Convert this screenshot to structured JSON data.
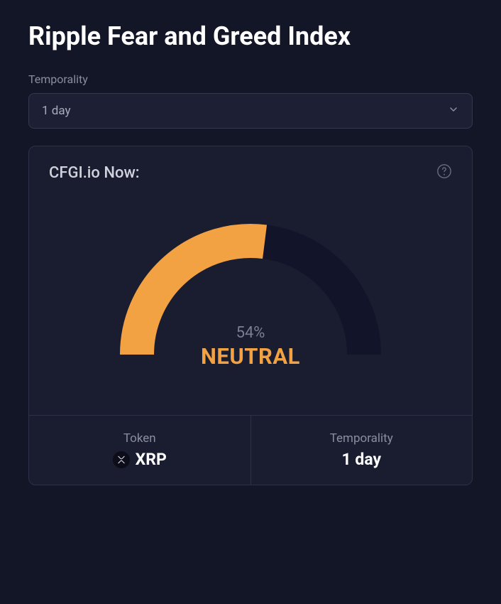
{
  "title": "Ripple Fear and Greed Index",
  "dropdown": {
    "label": "Temporality",
    "value": "1 day"
  },
  "card": {
    "title": "CFGI.io Now:",
    "gauge": {
      "percent_text": "54%",
      "label": "NEUTRAL"
    },
    "footer": {
      "token_label": "Token",
      "token_value": "XRP",
      "temporality_label": "Temporality",
      "temporality_value": "1 day"
    }
  },
  "colors": {
    "accent": "#f2a143",
    "track": "#12152a"
  },
  "chart_data": {
    "type": "gauge",
    "title": "CFGI.io Now:",
    "value": 54,
    "min": 0,
    "max": 100,
    "label": "NEUTRAL",
    "units": "%",
    "color": "#f2a143",
    "track_color": "#12152a"
  }
}
